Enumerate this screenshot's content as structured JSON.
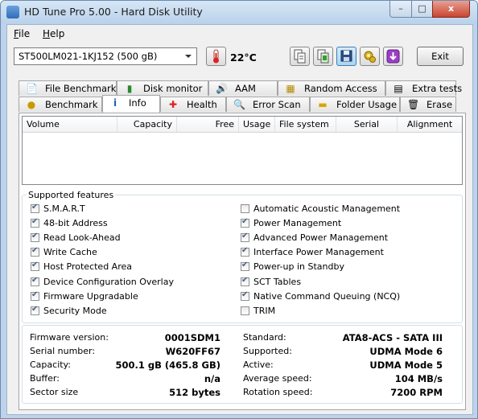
{
  "window": {
    "title": "HD Tune Pro 5.00 - Hard Disk Utility",
    "minimize_glyph": "–",
    "maximize_glyph": "□",
    "close_glyph": "x"
  },
  "menu": [
    {
      "label": "File",
      "key": "F",
      "rest": "ile"
    },
    {
      "label": "Help",
      "key": "H",
      "rest": "elp"
    }
  ],
  "toolbar": {
    "drive": "ST500LM021-1KJ152 (500 gB)",
    "temperature": "22°C",
    "icons": [
      "copy-text-icon",
      "copy-screen-icon",
      "save-icon",
      "options-icon",
      "download-icon"
    ],
    "exit_label": "Exit"
  },
  "tabs_top": [
    {
      "label": "File Benchmark",
      "icon": "file-benchmark-icon"
    },
    {
      "label": "Disk monitor",
      "icon": "disk-monitor-icon"
    },
    {
      "label": "AAM",
      "icon": "aam-speaker-icon"
    },
    {
      "label": "Random Access",
      "icon": "random-access-icon"
    },
    {
      "label": "Extra tests",
      "icon": "extra-tests-icon"
    }
  ],
  "tabs_bottom": [
    {
      "label": "Benchmark",
      "icon": "benchmark-icon"
    },
    {
      "label": "Info",
      "icon": "info-icon",
      "active": true
    },
    {
      "label": "Health",
      "icon": "health-cross-icon"
    },
    {
      "label": "Error Scan",
      "icon": "error-scan-magnifier-icon"
    },
    {
      "label": "Folder Usage",
      "icon": "folder-icon"
    },
    {
      "label": "Erase",
      "icon": "erase-bin-icon"
    }
  ],
  "partition_table": {
    "columns": [
      "Volume",
      "Capacity",
      "Free",
      "Usage",
      "File system",
      "Serial",
      "Alignment"
    ],
    "rows": []
  },
  "features": {
    "title": "Supported features",
    "left": [
      {
        "label": "S.M.A.R.T",
        "checked": true
      },
      {
        "label": "48-bit Address",
        "checked": true
      },
      {
        "label": "Read Look-Ahead",
        "checked": true
      },
      {
        "label": "Write Cache",
        "checked": true
      },
      {
        "label": "Host Protected Area",
        "checked": true
      },
      {
        "label": "Device Configuration Overlay",
        "checked": true
      },
      {
        "label": "Firmware Upgradable",
        "checked": true
      },
      {
        "label": "Security Mode",
        "checked": true
      }
    ],
    "right": [
      {
        "label": "Automatic Acoustic Management",
        "checked": false
      },
      {
        "label": "Power Management",
        "checked": true
      },
      {
        "label": "Advanced Power Management",
        "checked": true
      },
      {
        "label": "Interface Power Management",
        "checked": true
      },
      {
        "label": "Power-up in Standby",
        "checked": true
      },
      {
        "label": "SCT Tables",
        "checked": true
      },
      {
        "label": "Native Command Queuing (NCQ)",
        "checked": true
      },
      {
        "label": "TRIM",
        "checked": false
      }
    ]
  },
  "info": {
    "left": [
      {
        "label": "Firmware version:",
        "value": "0001SDM1"
      },
      {
        "label": "Serial number:",
        "value": "W620FF67"
      },
      {
        "label": "Capacity:",
        "value": "500.1 gB (465.8 GB)"
      },
      {
        "label": "Buffer:",
        "value": "n/a"
      },
      {
        "label": "Sector size",
        "value": "512 bytes"
      }
    ],
    "right": [
      {
        "label": "Standard:",
        "value": "ATA8-ACS - SATA III"
      },
      {
        "label": "Supported:",
        "value": "UDMA Mode 6"
      },
      {
        "label": "Active:",
        "value": "UDMA Mode 5"
      },
      {
        "label": "Average speed:",
        "value": "104 MB/s"
      },
      {
        "label": "Rotation speed:",
        "value": "7200 RPM"
      }
    ]
  }
}
